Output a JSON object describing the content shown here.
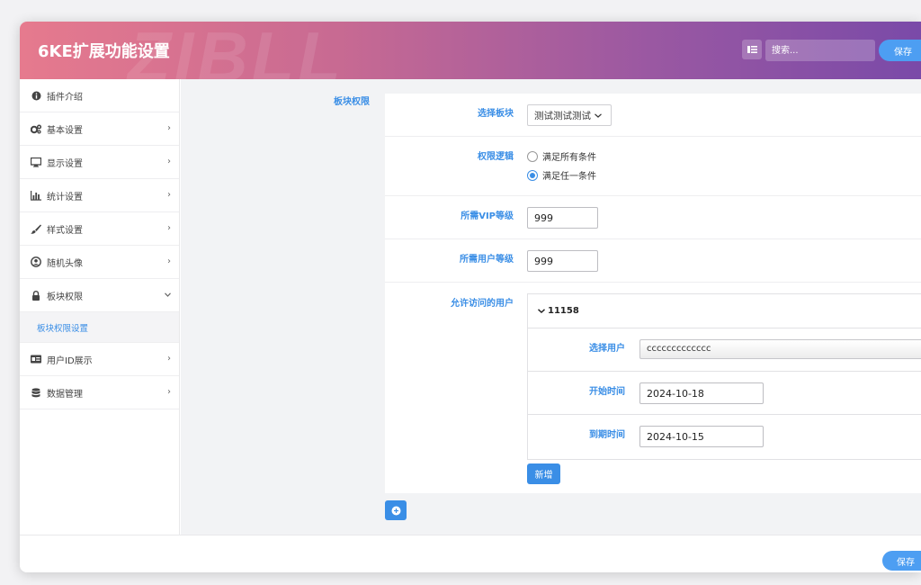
{
  "header": {
    "title": "6KE扩展功能设置",
    "watermark": "ZIBLL",
    "search_placeholder": "搜索...",
    "save_label": "保存"
  },
  "sidebar": {
    "items": [
      {
        "label": "插件介绍",
        "icon": "info-circle-icon",
        "expandable": false
      },
      {
        "label": "基本设置",
        "icon": "gears-icon",
        "expandable": true
      },
      {
        "label": "显示设置",
        "icon": "monitor-icon",
        "expandable": true
      },
      {
        "label": "统计设置",
        "icon": "bar-chart-icon",
        "expandable": true
      },
      {
        "label": "样式设置",
        "icon": "paintbrush-icon",
        "expandable": true
      },
      {
        "label": "随机头像",
        "icon": "user-circle-icon",
        "expandable": true
      },
      {
        "label": "板块权限",
        "icon": "lock-icon",
        "expandable": true,
        "expanded": true
      },
      {
        "label": "用户ID展示",
        "icon": "id-card-icon",
        "expandable": true
      },
      {
        "label": "数据管理",
        "icon": "database-icon",
        "expandable": true
      }
    ],
    "sub_item": "板块权限设置"
  },
  "main": {
    "section_label": "板块权限",
    "board": {
      "label": "选择板块",
      "value": "测试测试测试"
    },
    "logic": {
      "label": "权限逻辑",
      "options": [
        "满足所有条件",
        "满足任一条件"
      ],
      "selected_index": 1
    },
    "vip_level": {
      "label": "所需VIP等级",
      "value": "999"
    },
    "user_level": {
      "label": "所需用户等级",
      "value": "999"
    },
    "allowed_users": {
      "label": "允许访问的用户",
      "group_title": "11158",
      "select_user_label": "选择用户",
      "select_user_value": "ccccccccccccc",
      "start_label": "开始时间",
      "start_value": "2024-10-18",
      "end_label": "到期时间",
      "end_value": "2024-10-15",
      "add_label": "新增"
    }
  },
  "footer": {
    "save_label": "保存"
  },
  "colors": {
    "accent": "#3a8ee6",
    "header_start": "#e67a8e",
    "header_end": "#7a4aa8",
    "save_button": "#4d9ef2"
  }
}
